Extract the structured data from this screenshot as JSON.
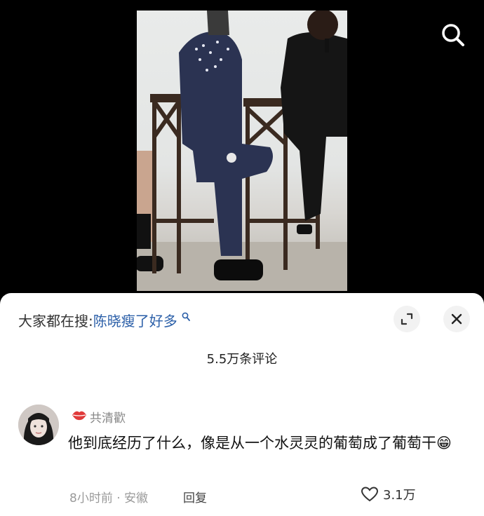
{
  "search_bar": {
    "prefix": "大家都在搜:",
    "keyword": "陈晓瘦了好多",
    "keyword_icon": "magnifier-icon"
  },
  "comments_header": {
    "count_label": "5.5万条评论"
  },
  "comment": {
    "username": "共清歡",
    "badge_icon": "kiss-lips-icon",
    "text": "他到底经历了什么，像是从一个水灵灵的葡萄成了葡萄干",
    "emoji": "😁",
    "time_location": "8小时前 · 安徽",
    "reply_label": "回复",
    "likes": "3.1万"
  },
  "colors": {
    "keyword": "#2b5fa8",
    "badge": "#e03a3a",
    "sheet_bg": "#ffffff"
  }
}
